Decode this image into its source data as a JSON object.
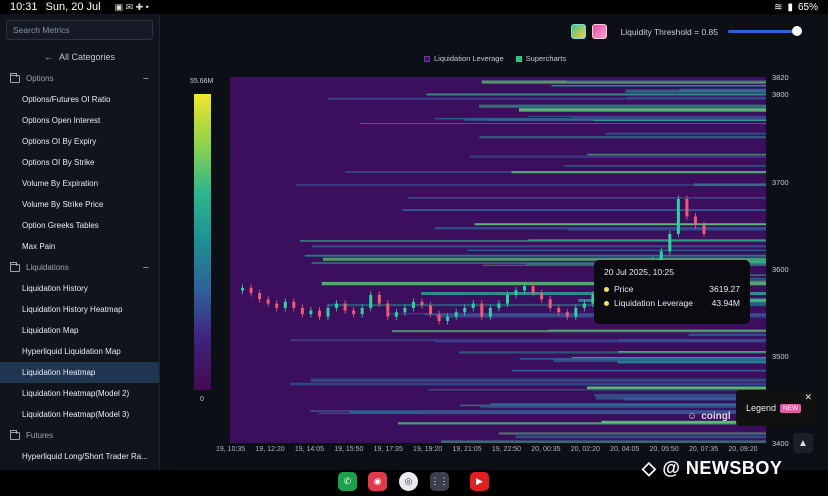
{
  "status": {
    "time": "10:31",
    "date": "Sun, 20 Jul",
    "battery": "65%"
  },
  "sidebar": {
    "search_placeholder": "Search Metrics",
    "all_categories": "All Categories",
    "sections": [
      {
        "label": "Options",
        "items": [
          "Options/Futures OI Ratio",
          "Options Open Interest",
          "Options OI By Expiry",
          "Options OI By Strike",
          "Volume By Expiration",
          "Volume By Strike Price",
          "Option Greeks Tables",
          "Max Pain"
        ]
      },
      {
        "label": "Liquidations",
        "items": [
          "Liquidation History",
          "Liquidation History Heatmap",
          "Liquidation Map",
          "Hyperliquid Liquidation Map",
          "Liquidation Heatmap",
          "Liquidation Heatmap(Model 2)",
          "Liquidation Heatmap(Model 3)"
        ]
      },
      {
        "label": "Futures",
        "items": [
          "Hyperliquid Long/Short Trader Ra..."
        ]
      }
    ],
    "active_item": "Liquidation Heatmap"
  },
  "toolbar": {
    "threshold_label": "Liquidity Threshold = 0.85",
    "threshold_value": 0.85
  },
  "chart_legend": {
    "series1": "Liquidation Leverage",
    "series2": "Supercharts",
    "color1": "#3a1060",
    "color2": "#2fc28a"
  },
  "scale": {
    "max_label": "55.66M",
    "min_label": "0"
  },
  "chart_data": {
    "type": "heatmap",
    "y_ticks": [
      "3820",
      "3800",
      "3700",
      "3600",
      "3500",
      "3400"
    ],
    "ylim": [
      3400,
      3820
    ],
    "x_ticks": [
      "19, 10:35",
      "19, 12:20",
      "19, 14:05",
      "19, 15:50",
      "19, 17:35",
      "19, 19:20",
      "19, 21:05",
      "19, 22:50",
      "20, 00:35",
      "20, 02:20",
      "20, 04:05",
      "20, 05:50",
      "20, 07:35",
      "20, 09:20"
    ],
    "price_series": [
      3575,
      3578,
      3572,
      3565,
      3560,
      3555,
      3562,
      3555,
      3548,
      3552,
      3545,
      3555,
      3560,
      3552,
      3548,
      3555,
      3570,
      3560,
      3545,
      3550,
      3555,
      3562,
      3558,
      3548,
      3540,
      3545,
      3550,
      3555,
      3560,
      3545,
      3555,
      3560,
      3570,
      3575,
      3580,
      3572,
      3565,
      3555,
      3550,
      3545,
      3555,
      3560,
      3570,
      3575,
      3585,
      3580,
      3590,
      3595,
      3600,
      3610,
      3620,
      3640,
      3680,
      3660,
      3650,
      3640
    ],
    "tooltip": {
      "time": "20 Jul 2025, 10:25",
      "price_label": "Price",
      "price_value": "3619.27",
      "lev_label": "Liquidation Leverage",
      "lev_value": "43.94M"
    }
  },
  "watermark": "coingl",
  "legend_button": {
    "label": "Legend",
    "badge": "NEW"
  },
  "brand": "@ NEWSBOY"
}
